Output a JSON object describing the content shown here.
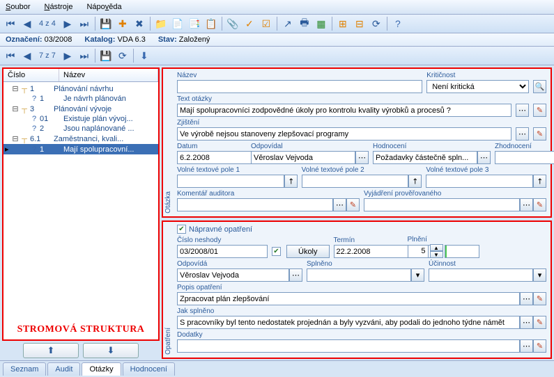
{
  "menu": {
    "file": "Soubor",
    "tools": "Nástroje",
    "help": "Nápověda"
  },
  "nav1": {
    "counter": "4 z 4"
  },
  "info": {
    "label_ozn": "Označení:",
    "ozn": "03/2008",
    "label_kat": "Katalog:",
    "kat": "VDA 6.3",
    "label_stav": "Stav:",
    "stav": "Založený"
  },
  "nav2": {
    "counter": "7 z 7"
  },
  "tree": {
    "col_cislo": "Číslo",
    "col_nazev": "Název",
    "rows": [
      {
        "indent": 0,
        "exp": "⊟",
        "ico": "┬",
        "num": "1",
        "txt": "Plánování návrhu"
      },
      {
        "indent": 1,
        "exp": "",
        "ico": "?",
        "num": "1",
        "txt": "Je návrh plánován"
      },
      {
        "indent": 0,
        "exp": "⊟",
        "ico": "┬",
        "num": "3",
        "txt": "Plánování vývoje"
      },
      {
        "indent": 1,
        "exp": "",
        "ico": "?",
        "num": "01",
        "txt": "Existuje plán vývoj..."
      },
      {
        "indent": 1,
        "exp": "",
        "ico": "?",
        "num": "2",
        "txt": "Jsou naplánované ..."
      },
      {
        "indent": 0,
        "exp": "⊟",
        "ico": "┬",
        "num": "6.1",
        "txt": "Zaměstnanci, kvali..."
      },
      {
        "indent": 1,
        "exp": "",
        "ico": "?",
        "num": "1",
        "txt": "Mají spolupracovní...",
        "sel": true,
        "mark": "▸"
      }
    ],
    "caption": "STROMOVÁ STRUKTURA"
  },
  "q": {
    "label_nazev": "Název",
    "nazev": "",
    "label_krit": "Kritičnost",
    "krit": "Není kritická",
    "label_text": "Text otázky",
    "text": "Mají spolupracovníci zodpovědné úkoly pro kontrolu kvality výrobků a procesů ?",
    "label_zjist": "Zjištění",
    "zjist": "Ve výrobě nejsou stanoveny zlepšovací programy",
    "label_datum": "Datum",
    "datum": "6.2.2008",
    "label_odp": "Odpovídal",
    "odp": "Věroslav Vejvoda",
    "label_hod": "Hodnocení",
    "hod": "Požadavky částečně spln...",
    "label_zhod": "Zhodnocení",
    "zhod": "",
    "label_vp1": "Volné textové pole 1",
    "label_vp2": "Volné textové pole 2",
    "label_vp3": "Volné textové pole 3",
    "label_kom": "Komentář auditora",
    "label_vyj": "Vyjádření prověřovaného",
    "panel_label": "Otázka"
  },
  "op": {
    "checkbox_label": "Nápravné opatření",
    "label_cn": "Číslo neshody",
    "cn": "03/2008/01",
    "ukoly": "Úkoly",
    "label_term": "Termín",
    "term": "22.2.2008",
    "label_pln": "Plnění",
    "pln": "5",
    "label_odp": "Odpovídá",
    "odp": "Věroslav Vejvoda",
    "label_spl": "Splněno",
    "label_uc": "Účinnost",
    "label_popis": "Popis opatření",
    "popis": "Zpracovat plán zlepšování",
    "label_jak": "Jak splněno",
    "jak": "S pracovníky byl tento nedostatek projednán a byly vyzváni, aby podali do jednoho týdne námět",
    "label_dod": "Dodatky",
    "panel_label": "Opatření"
  },
  "tabs": {
    "t1": "Seznam",
    "t2": "Audit",
    "t3": "Otázky",
    "t4": "Hodnocení"
  }
}
